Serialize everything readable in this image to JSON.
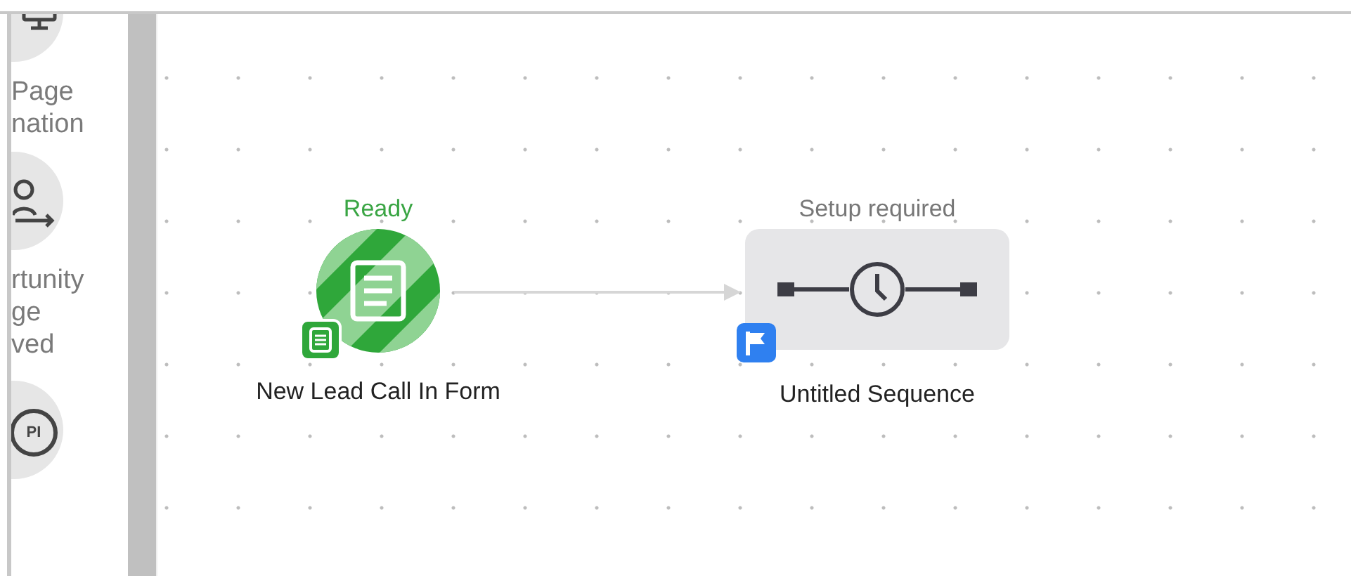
{
  "sidebar": {
    "items": [
      {
        "kind": "monitor",
        "label_lines": [
          "Page",
          "nation"
        ]
      },
      {
        "kind": "person-arrow",
        "label_lines": [
          "rtunity",
          "ge",
          "ved"
        ]
      },
      {
        "kind": "api",
        "icon_text": "PI"
      }
    ]
  },
  "canvas": {
    "nodes": [
      {
        "kind": "form",
        "status": "Ready",
        "label": "New Lead Call In Form"
      },
      {
        "kind": "sequence",
        "status": "Setup required",
        "label": "Untitled Sequence"
      }
    ]
  }
}
